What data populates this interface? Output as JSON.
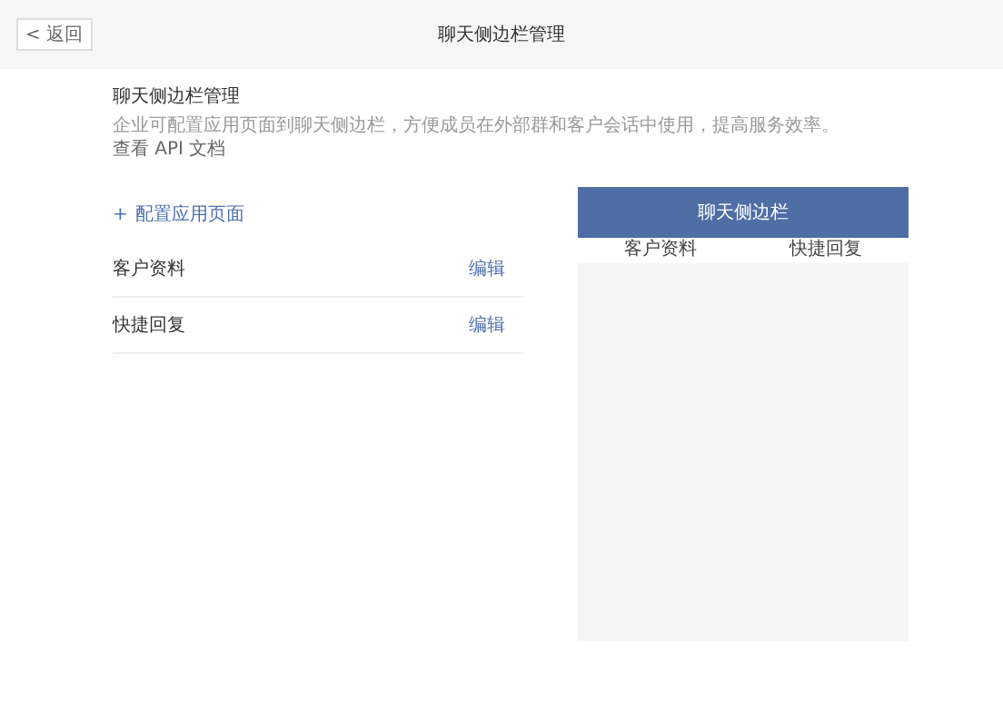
{
  "top_bar": {
    "back_button": "< 返回",
    "title": "聊天侧边栏管理"
  },
  "header": {
    "title": "聊天侧边栏管理",
    "description": "企业可配置应用页面到聊天侧边栏，方便成员在外部群和客户会话中使用，提高服务效率。",
    "link": "查看 API 文档"
  },
  "add_link": {
    "icon": "+",
    "label": "配置应用页面"
  },
  "pages": [
    {
      "name": "客户资料",
      "action": "编辑"
    },
    {
      "name": "快捷回复",
      "action": "编辑"
    }
  ],
  "preview": {
    "title": "聊天侧边栏",
    "tabs": [
      {
        "label": "客户资料"
      },
      {
        "label": "快捷回复"
      }
    ]
  }
}
